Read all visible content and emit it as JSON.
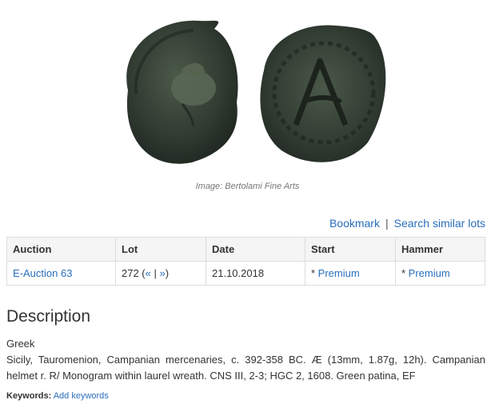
{
  "image": {
    "caption": "Image: Bertolami Fine Arts",
    "obverse_icon": "coin-obverse-helmet-icon",
    "reverse_icon": "coin-reverse-monogram-icon"
  },
  "actions": {
    "bookmark": "Bookmark",
    "separator": "|",
    "search_similar": "Search similar lots"
  },
  "lot_table": {
    "headers": [
      "Auction",
      "Lot",
      "Date",
      "Start",
      "Hammer"
    ],
    "auction": "E-Auction 63",
    "lot_number": "272 (",
    "prev": "«",
    "pipe": " | ",
    "next": "»",
    "lot_close": ")",
    "date": "21.10.2018",
    "start_prefix": "* ",
    "start_link": "Premium",
    "hammer_prefix": "* ",
    "hammer_link": "Premium"
  },
  "description": {
    "heading": "Description",
    "category": "Greek",
    "text": "Sicily, Tauromenion, Campanian mercenaries, c. 392-358 BC. Æ (13mm, 1.87g, 12h). Campanian helmet r. R/ Monogram within laurel wreath. CNS III, 2-3; HGC 2, 1608. Green patina, EF"
  },
  "keywords": {
    "label": "Keywords:",
    "add_link": "Add keywords"
  },
  "colors": {
    "link": "#2a6ebb",
    "coin": "#2f3a30",
    "header_bg": "#f5f5f5"
  }
}
